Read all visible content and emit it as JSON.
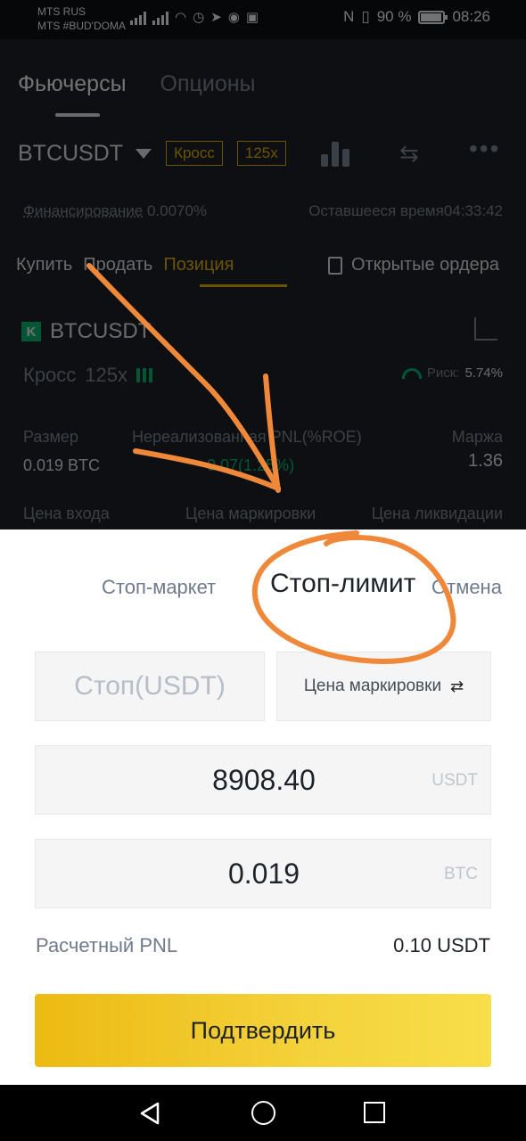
{
  "status_bar": {
    "carrier_1": "MTS RUS",
    "carrier_2": "MTS #BUD'DOMA",
    "battery": "90 %",
    "time": "08:26"
  },
  "tabs": [
    "Фьючерсы",
    "Опционы"
  ],
  "symbol": "BTCUSDT",
  "badges": {
    "margin_mode": "Кросс",
    "leverage": "125x"
  },
  "funding": {
    "label": "Финансирование",
    "value": "0.0070%"
  },
  "remaining": {
    "label": "Оставшееся время",
    "value": "04:33:42"
  },
  "subtabs": {
    "buy": "Купить",
    "sell": "Продать",
    "position": "Позиция",
    "open_orders": "Открытые ордера"
  },
  "position": {
    "symbol": "BTCUSDT",
    "mode": "Кросс",
    "leverage": "125x",
    "risk_label": "Риск:",
    "risk_value": "5.74%",
    "size_label": "Размер",
    "size_value": "0.019 BTC",
    "pnl_label": "Нереализованная PNL(%ROE)",
    "pnl_value": "0.07(1.25%)",
    "margin_label": "Маржа",
    "margin_value": "1.36",
    "entry_label": "Цена входа",
    "mark_label": "Цена маркировки",
    "liq_label": "Цена ликвидации"
  },
  "sheet": {
    "tab_stop_market": "Стоп-маркет",
    "tab_stop_limit": "Стоп-лимит",
    "tab_cancel": "Отмена",
    "stop_placeholder": "Стоп(USDT)",
    "price_type": "Цена маркировки",
    "price_value": "8908.40",
    "price_unit": "USDT",
    "amount_value": "0.019",
    "amount_unit": "BTC",
    "pnl_label": "Расчетный PNL",
    "pnl_value": "0.10 USDT",
    "confirm_label": "Подтвердить"
  },
  "colors": {
    "accent": "#f0b90b",
    "positive": "#02c076",
    "annotation": "#f0883a"
  },
  "icons": [
    "signal-icon",
    "wifi-icon",
    "alarm-icon",
    "telegram-icon",
    "chrome-icon",
    "nfc-icon",
    "vibrate-icon",
    "battery-icon",
    "dropdown-caret-icon",
    "chart-bars-icon",
    "swap-icon",
    "more-icon",
    "clipboard-icon",
    "share-icon",
    "gauge-icon",
    "back-icon",
    "home-icon",
    "recents-icon"
  ]
}
